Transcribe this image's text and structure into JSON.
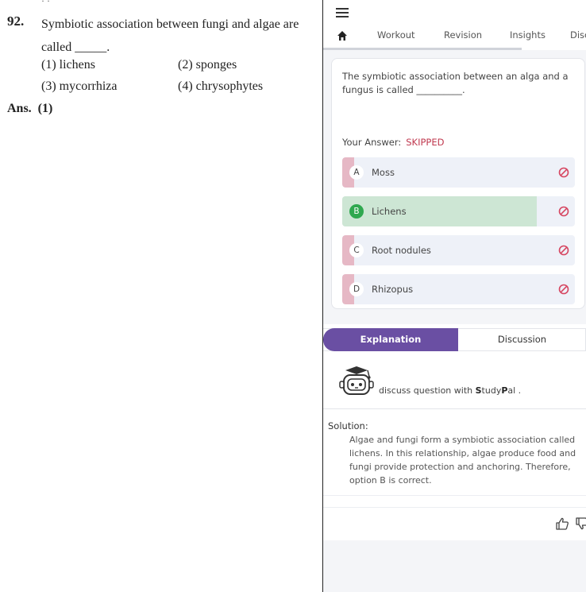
{
  "book": {
    "number": "92.",
    "question_line1": "Symbiotic association between fungi and algae are",
    "question_line2": "called _____.",
    "options": [
      {
        "num": "(1)",
        "text": "lichens"
      },
      {
        "num": "(2)",
        "text": "sponges"
      },
      {
        "num": "(3)",
        "text": "mycorrhiza"
      },
      {
        "num": "(4)",
        "text": "chrysophytes"
      }
    ],
    "answer": "Ans.  (1)"
  },
  "app": {
    "tabs": [
      "Workout",
      "Revision",
      "Insights",
      "Disc"
    ],
    "question": "The symbiotic association between an alga and a fungus is called __________.",
    "your_answer_label": "Your Answer:",
    "your_answer_value": "SKIPPED",
    "options": [
      {
        "letter": "A",
        "label": "Moss"
      },
      {
        "letter": "B",
        "label": "Lichens"
      },
      {
        "letter": "C",
        "label": "Root nodules"
      },
      {
        "letter": "D",
        "label": "Rhizopus"
      }
    ],
    "subtabs": {
      "explanation": "Explanation",
      "discussion": "Discussion"
    },
    "studypal": {
      "prefix": "discuss question with ",
      "brand_s": "S",
      "brand_tudy": "tudy",
      "brand_p": "P",
      "brand_al": "al",
      "suffix": " ."
    },
    "solution_title": "Solution:",
    "solution_text": "Algae and fungi form a symbiotic association called lichens. In this relationship, algae produce food and fungi provide protection and anchoring. Therefore, option B is correct.",
    "colors": {
      "accent": "#6a4fa3",
      "correct": "#2fa84f",
      "wrong": "#d64560",
      "skipped": "#c0394f"
    }
  }
}
